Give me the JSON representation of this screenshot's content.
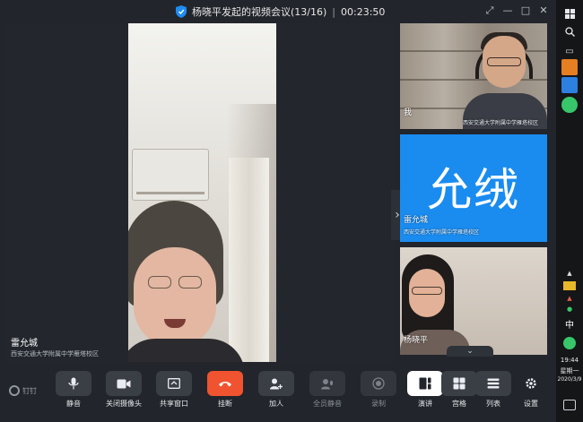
{
  "window": {
    "title": "杨晓平发起的视频会议(13/16)",
    "separator": "|",
    "timer": "00:23:50",
    "controls": [
      "pin-icon",
      "minimize-icon",
      "maximize-icon",
      "close-icon"
    ]
  },
  "stage": {
    "speaker_name": "雷允城",
    "speaker_org": "西安交通大学附属中学雁塔校区"
  },
  "tiles": [
    {
      "name": "我",
      "org": "西安交通大学附属中学雁塔校区"
    },
    {
      "avatar_text": "允绒",
      "name": "雷允城",
      "org": "西安交通大学附属中学雁塔校区",
      "color": "#1a8cf0"
    },
    {
      "name": "杨晓平"
    }
  ],
  "toolbar": {
    "logo": "钉钉",
    "mute": "静音",
    "camera_off": "关闭摄像头",
    "share_window": "共享窗口",
    "hang_up": "挂断",
    "add": "加人",
    "mute_all": "全员静音",
    "record": "录制",
    "layout_speaker": "演讲",
    "layout_grid": "宫格",
    "layout_list": "列表",
    "settings": "设置",
    "hangup_color": "#f0532f"
  },
  "taskbar": {
    "lang": "中",
    "time": "19:44",
    "weekday": "星期一",
    "date": "2020/3/9"
  }
}
